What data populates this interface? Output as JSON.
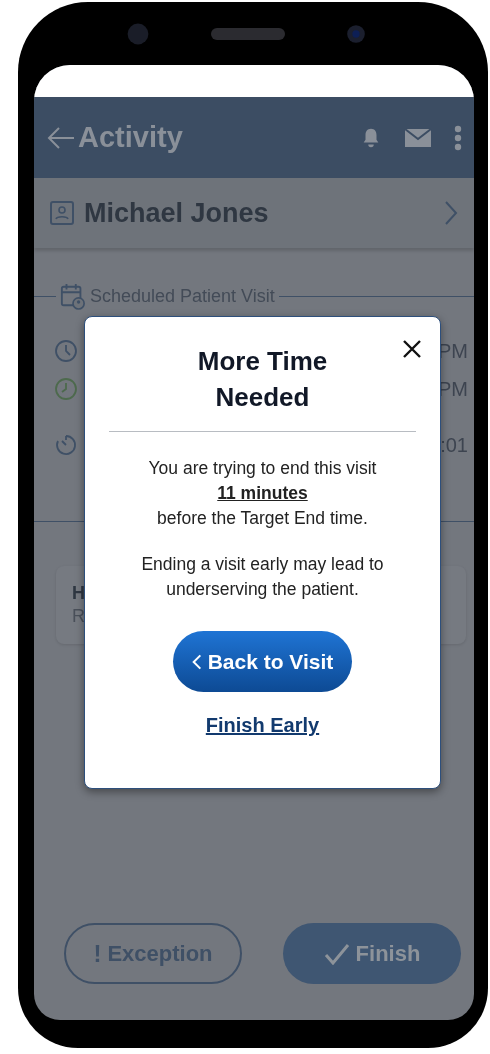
{
  "app_bar": {
    "title": "Activity"
  },
  "patient": {
    "name": "Michael Jones"
  },
  "section": {
    "title": "Scheduled Patient Visit"
  },
  "visit_rows": [
    {
      "kind": "scheduled",
      "value": "PM"
    },
    {
      "kind": "actual",
      "value": "PM"
    },
    {
      "kind": "duration",
      "value": ":01"
    }
  ],
  "task_card": {
    "title": "H",
    "subtitle": "R"
  },
  "actions": [
    {
      "kind": "exception",
      "icon_text": "!",
      "label": "Exception"
    },
    {
      "kind": "finish",
      "label": "Finish"
    }
  ],
  "dialog": {
    "title": "More Time Needed",
    "message_start": "You are trying to end this visit",
    "message_emphasis": "11 minutes",
    "message_end": "before the Target End time.",
    "warning": "Ending a visit early may lead to underserving the patient.",
    "primary_button": "Back to Visit",
    "link": "Finish Early"
  }
}
